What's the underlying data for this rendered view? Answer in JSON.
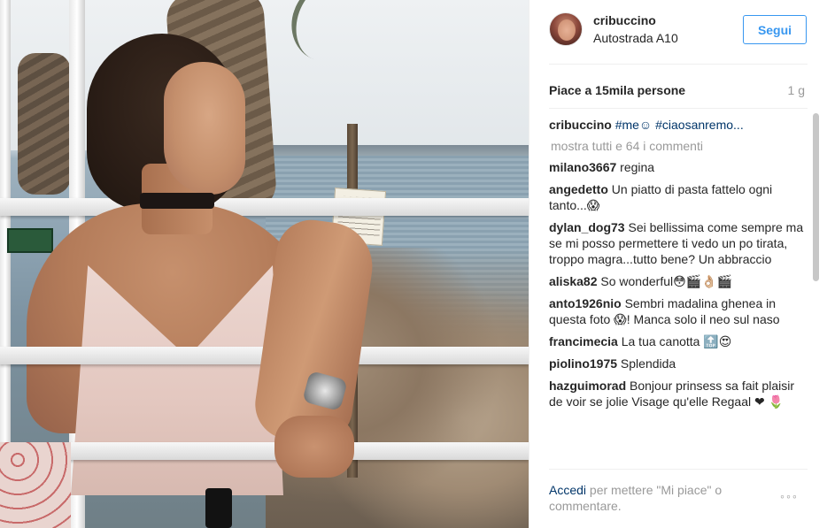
{
  "post": {
    "username": "cribuccino",
    "location": "Autostrada A10",
    "follow_label": "Segui",
    "likes_text": "Piace a 15mila persone",
    "age": "1 g",
    "caption": {
      "user": "cribuccino",
      "text": "#me☺ #ciaosanremo..."
    },
    "show_all": "mostra tutti e 64 i commenti",
    "comments": [
      {
        "user": "milano3667",
        "text": "regina"
      },
      {
        "user": "angedetto",
        "text": "Un piatto di pasta fattelo ogni tanto...😱"
      },
      {
        "user": "dylan_dog73",
        "text": "Sei bellissima come sempre ma se mi posso permettere ti vedo un po tirata, troppo magra...tutto bene? Un abbraccio"
      },
      {
        "user": "aliska82",
        "text": "So wonderful😳🎬👌🏼🎬"
      },
      {
        "user": "anto1926nio",
        "text": "Sembri madalina ghenea in questa foto 😱! Manca solo il neo sul naso"
      },
      {
        "user": "francimecia",
        "text": "La tua canotta 🔝😍"
      },
      {
        "user": "piolino1975",
        "text": "Splendida"
      },
      {
        "user": "hazguimorad",
        "text": "Bonjour prinsess sa fait plaisir de voir se jolie Visage qu'elle Regaal ❤ 🌷"
      }
    ],
    "footer": {
      "login_link": "Accedi",
      "rest": " per mettere \"Mi piace\" o commentare."
    },
    "more_options": "◦◦◦"
  },
  "colors": {
    "accent": "#3897f0",
    "link": "#003569",
    "muted": "#999999",
    "text": "#262626"
  },
  "icons": {
    "more": "more-options-icon"
  }
}
